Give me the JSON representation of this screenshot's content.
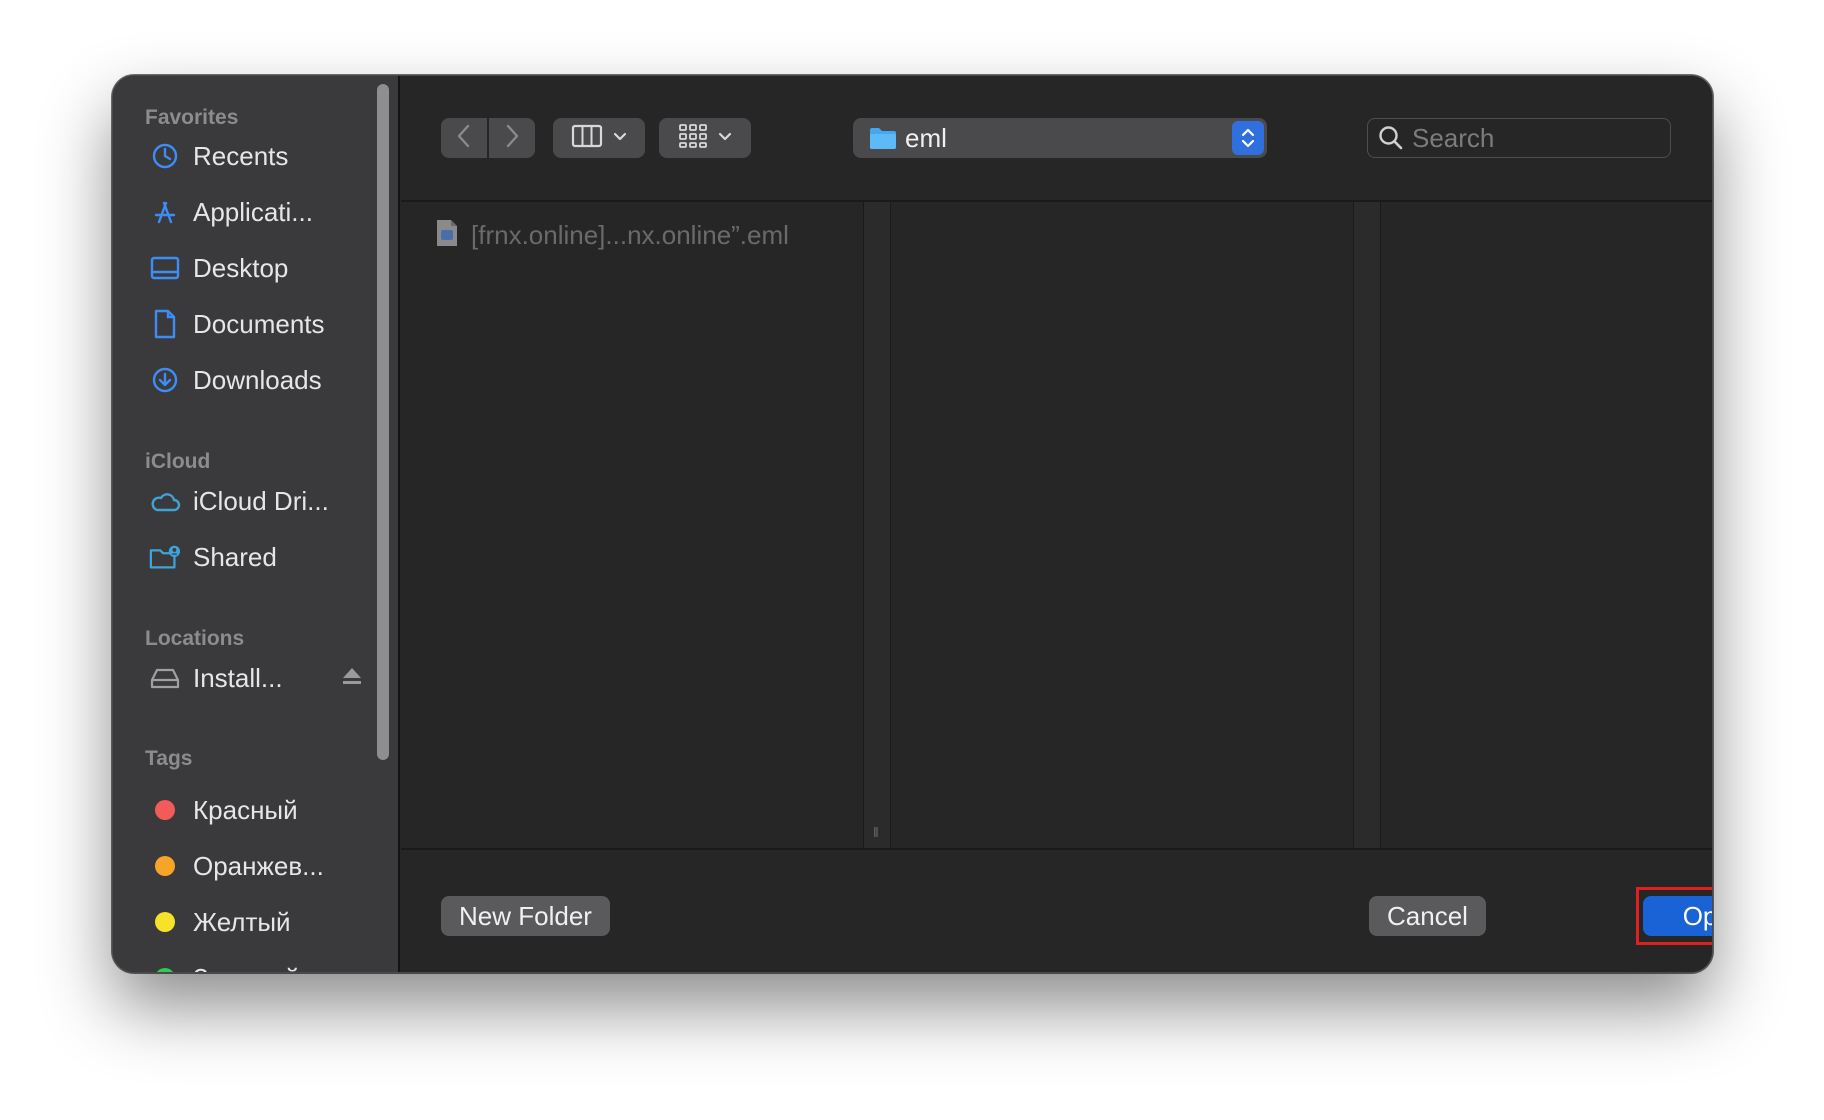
{
  "sidebar": {
    "sections": [
      {
        "title": "Favorites",
        "items": [
          {
            "label": "Recents",
            "icon": "clock-icon"
          },
          {
            "label": "Applicati...",
            "icon": "applications-icon"
          },
          {
            "label": "Desktop",
            "icon": "desktop-icon"
          },
          {
            "label": "Documents",
            "icon": "document-icon"
          },
          {
            "label": "Downloads",
            "icon": "download-icon"
          }
        ]
      },
      {
        "title": "iCloud",
        "items": [
          {
            "label": "iCloud Dri...",
            "icon": "cloud-icon"
          },
          {
            "label": "Shared",
            "icon": "shared-folder-icon"
          }
        ]
      },
      {
        "title": "Locations",
        "items": [
          {
            "label": "Install...",
            "icon": "drive-icon"
          }
        ]
      },
      {
        "title": "Tags",
        "items": [
          {
            "label": "Красный",
            "color": "#f25b57"
          },
          {
            "label": "Оранжев...",
            "color": "#f7a528"
          },
          {
            "label": "Желтый",
            "color": "#f7e22a"
          },
          {
            "label": "Зеленый",
            "color": "#2ecc52"
          }
        ]
      }
    ]
  },
  "toolbar": {
    "path_folder": "eml",
    "search_placeholder": "Search"
  },
  "browser": {
    "files": [
      {
        "name": "[frnx.online]...nx.online”.eml",
        "icon": "eml-file-icon"
      }
    ]
  },
  "footer": {
    "new_folder": "New Folder",
    "cancel": "Cancel",
    "open": "Open"
  },
  "colors": {
    "accent": "#1a63d6",
    "highlight": "#e0201c"
  }
}
